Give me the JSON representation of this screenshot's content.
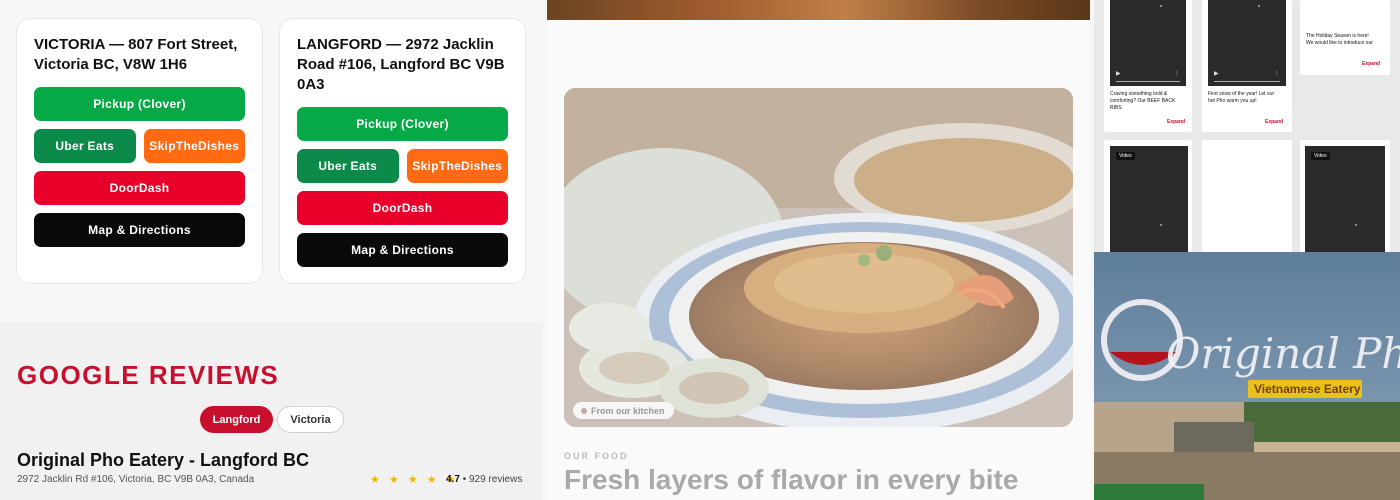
{
  "locations": [
    {
      "title": "VICTORIA — 807 Fort Street, Victoria BC, V8W 1H6",
      "pickup": "Pickup (Clover)",
      "uber": "Uber Eats",
      "skip": "SkipTheDishes",
      "doordash": "DoorDash",
      "map": "Map & Directions"
    },
    {
      "title": "LANGFORD — 2972 Jacklin Road #106, Langford BC V9B 0A3",
      "pickup": "Pickup (Clover)",
      "uber": "Uber Eats",
      "skip": "SkipTheDishes",
      "doordash": "DoorDash",
      "map": "Map & Directions"
    }
  ],
  "reviews": {
    "title": "GOOGLE REVIEWS",
    "tabs": [
      "Langford",
      "Victoria"
    ],
    "active_tab": "Langford",
    "business_name": "Original Pho Eatery - Langford BC",
    "address": "2972 Jacklin Rd #106, Victoria, BC V9B 0A3, Canada",
    "stars": "★ ★ ★ ★ ★",
    "rating": "4.7",
    "review_count": "• 929 reviews"
  },
  "food": {
    "badge": "From our kitchen",
    "eyebrow": "OUR FOOD",
    "headline": "Fresh layers of flavor in every bite"
  },
  "social": {
    "post1_caption": "Craving something bold & comforting? Our BEEF BACK RIBS",
    "post2_caption": "First snow of the year! Let our hot Pho warm you up!",
    "post3_caption": "The Holiday Season is here! We would like to introduce our",
    "expand": "Expand",
    "video_tag": "Video"
  },
  "store_sign": {
    "brand": "Original Pho",
    "subtitle": "Vietnamese Eatery"
  },
  "colors": {
    "brand_red": "#c8102e",
    "pickup_green": "#07a846",
    "uber_green": "#0b8a4a",
    "skip_orange": "#ff6a13",
    "doordash_red": "#e8002b",
    "map_black": "#0a0a0a",
    "star_gold": "#f4b400"
  }
}
